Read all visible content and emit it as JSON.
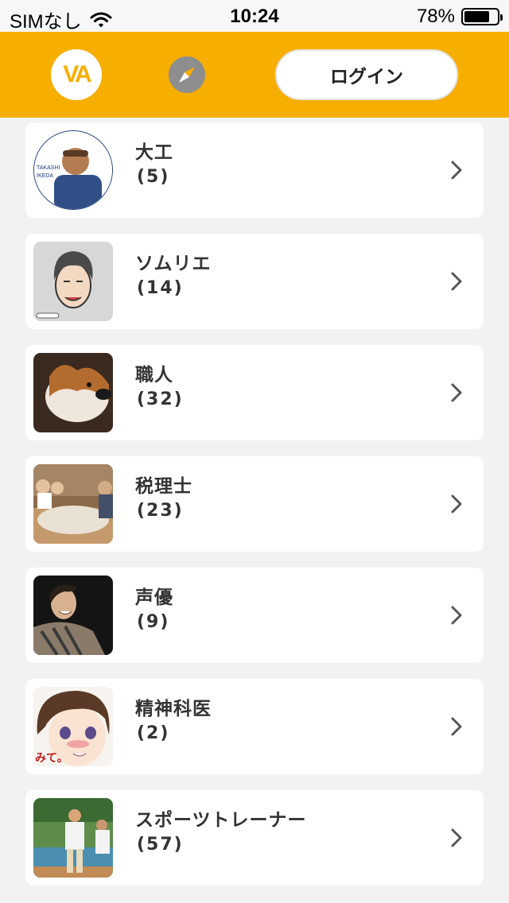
{
  "status_bar": {
    "carrier": "SIMなし",
    "time": "10:24",
    "battery": "78%",
    "battery_level": 0.78
  },
  "header": {
    "logo_text": "VA",
    "login_label": "ログイン",
    "colors": {
      "background": "#f6ae00",
      "compass": "#8e8e8e"
    }
  },
  "categories": [
    {
      "title": "大工",
      "count": "(5)",
      "thumb_icon": "carpenter-photo"
    },
    {
      "title": "ソムリエ",
      "count": "(14)",
      "thumb_icon": "cartoon-man-avatar"
    },
    {
      "title": "職人",
      "count": "(32)",
      "thumb_icon": "corgi-dog-photo"
    },
    {
      "title": "税理士",
      "count": "(23)",
      "thumb_icon": "restaurant-group-photo"
    },
    {
      "title": "声優",
      "count": "(9)",
      "thumb_icon": "smiling-person-photo"
    },
    {
      "title": "精神科医",
      "count": "(2)",
      "thumb_icon": "anime-girl-illustration"
    },
    {
      "title": "スポーツトレーナー",
      "count": "(57)",
      "thumb_icon": "sports-field-photo"
    }
  ]
}
